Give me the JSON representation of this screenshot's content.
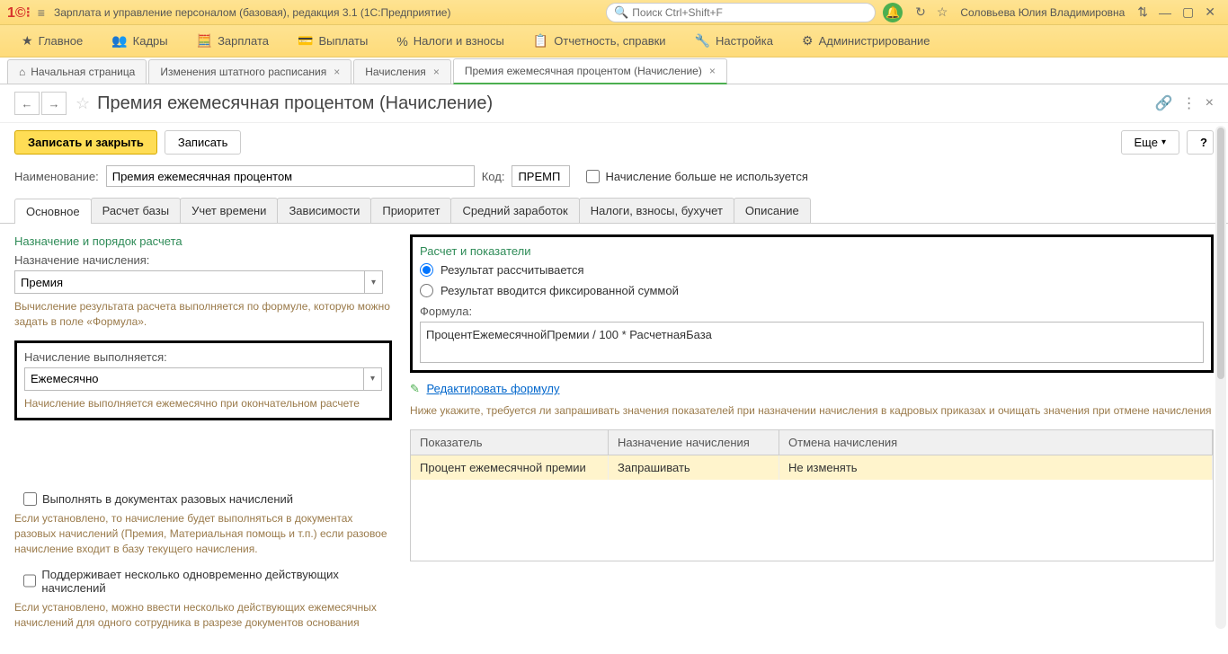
{
  "titlebar": {
    "app_title": "Зарплата и управление персоналом (базовая), редакция 3.1  (1С:Предприятие)",
    "search_placeholder": "Поиск Ctrl+Shift+F",
    "username": "Соловьева Юлия Владимировна"
  },
  "menubar": [
    {
      "icon": "★",
      "label": "Главное"
    },
    {
      "icon": "👥",
      "label": "Кадры"
    },
    {
      "icon": "📊",
      "label": "Зарплата"
    },
    {
      "icon": "💳",
      "label": "Выплаты"
    },
    {
      "icon": "%",
      "label": "Налоги и взносы"
    },
    {
      "icon": "📋",
      "label": "Отчетность, справки"
    },
    {
      "icon": "🔧",
      "label": "Настройка"
    },
    {
      "icon": "⚙",
      "label": "Администрирование"
    }
  ],
  "tabs": [
    {
      "label": "Начальная страница",
      "home": true
    },
    {
      "label": "Изменения штатного расписания",
      "closable": true
    },
    {
      "label": "Начисления",
      "closable": true
    },
    {
      "label": "Премия ежемесячная процентом (Начисление)",
      "closable": true,
      "active": true
    }
  ],
  "page": {
    "title": "Премия ежемесячная процентом (Начисление)",
    "save_close": "Записать и закрыть",
    "save": "Записать",
    "more": "Еще",
    "help": "?"
  },
  "header_fields": {
    "name_label": "Наименование:",
    "name_value": "Премия ежемесячная процентом",
    "code_label": "Код:",
    "code_value": "ПРЕМП",
    "unused_label": "Начисление больше не используется"
  },
  "inner_tabs": [
    "Основное",
    "Расчет базы",
    "Учет времени",
    "Зависимости",
    "Приоритет",
    "Средний заработок",
    "Налоги, взносы, бухучет",
    "Описание"
  ],
  "left": {
    "section1_title": "Назначение и порядок расчета",
    "purpose_label": "Назначение начисления:",
    "purpose_value": "Премия",
    "purpose_help": "Вычисление результата расчета выполняется по формуле, которую можно задать в поле «Формула».",
    "exec_label": "Начисление выполняется:",
    "exec_value": "Ежемесячно",
    "exec_help": "Начисление выполняется ежемесячно при окончательном расчете",
    "cb1_label": "Выполнять в документах разовых начислений",
    "cb1_help": "Если установлено, то начисление будет выполняться в документах разовых начислений (Премия, Материальная помощь и т.п.) если разовое начисление входит в базу текущего начисления.",
    "cb2_label": "Поддерживает несколько одновременно действующих начислений",
    "cb2_help": "Если установлено, можно ввести несколько действующих ежемесячных начислений для одного сотрудника в разрезе документов основания"
  },
  "right": {
    "section_title": "Расчет и показатели",
    "radio1": "Результат рассчитывается",
    "radio2": "Результат вводится фиксированной суммой",
    "formula_label": "Формула:",
    "formula_value": "ПроцентЕжемесячнойПремии / 100 * РасчетнаяБаза",
    "edit_link": "Редактировать формулу",
    "grid_help": "Ниже укажите, требуется ли запрашивать значения показателей при назначении начисления в кадровых приказах и очищать значения при отмене начисления",
    "grid_headers": [
      "Показатель",
      "Назначение начисления",
      "Отмена начисления"
    ],
    "grid_row": [
      "Процент ежемесячной премии",
      "Запрашивать",
      "Не изменять"
    ]
  }
}
